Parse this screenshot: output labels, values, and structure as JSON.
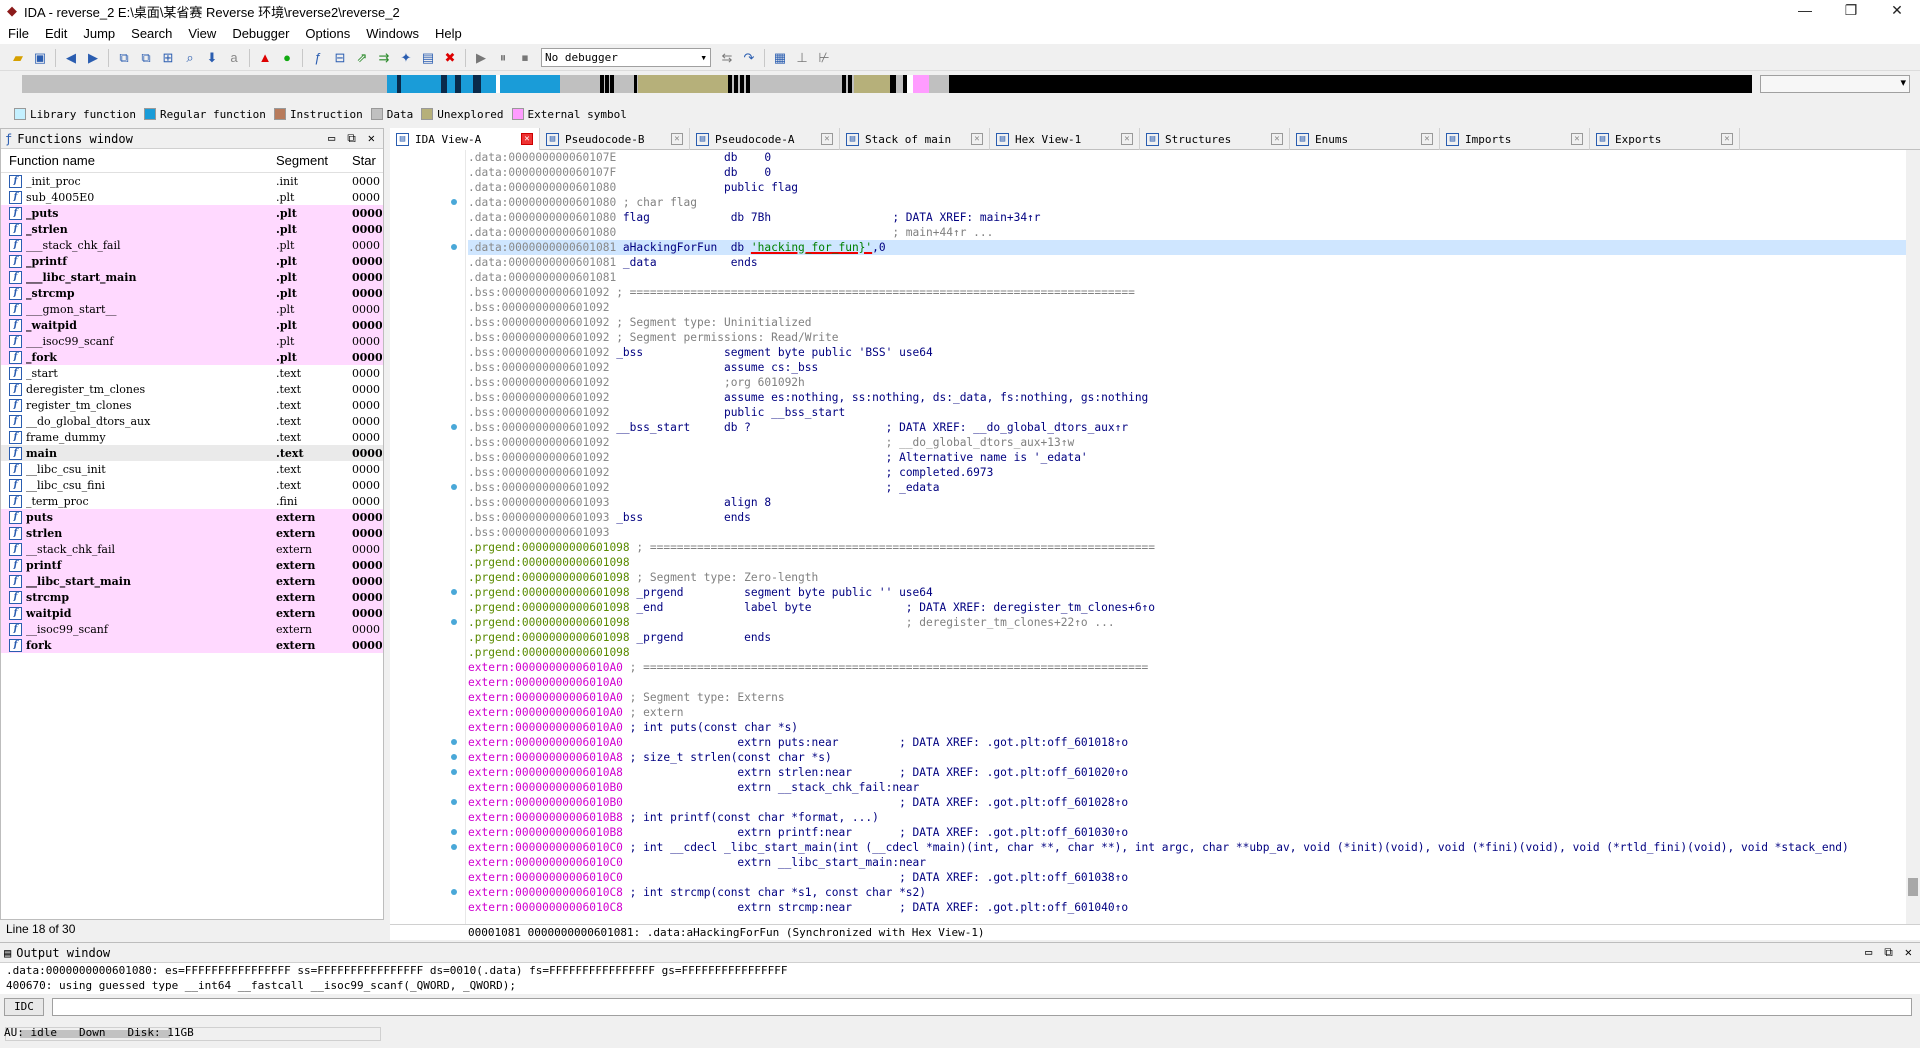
{
  "window": {
    "title": "IDA - reverse_2 E:\\桌面\\某省赛 Reverse 环境\\reverse2\\reverse_2"
  },
  "menu": [
    "File",
    "Edit",
    "Jump",
    "Search",
    "View",
    "Debugger",
    "Options",
    "Windows",
    "Help"
  ],
  "toolbar": {
    "debugger_select": "No debugger"
  },
  "legend": [
    {
      "label": "Library function",
      "color": "#c4f0ff"
    },
    {
      "label": "Regular function",
      "color": "#1a9cd8"
    },
    {
      "label": "Instruction",
      "color": "#b77b5c"
    },
    {
      "label": "Data",
      "color": "#c0c0c0"
    },
    {
      "label": "Unexplored",
      "color": "#b6b07a"
    },
    {
      "label": "External symbol",
      "color": "#ff9cff"
    }
  ],
  "functions_window": {
    "title": "Functions window",
    "columns": [
      "Function name",
      "Segment",
      "Star"
    ],
    "rows": [
      {
        "name": "_init_proc",
        "seg": ".init",
        "start": "0000",
        "style": ""
      },
      {
        "name": "sub_4005E0",
        "seg": ".plt",
        "start": "0000",
        "style": ""
      },
      {
        "name": "_puts",
        "seg": ".plt",
        "start": "0000",
        "style": "pink bold"
      },
      {
        "name": "_strlen",
        "seg": ".plt",
        "start": "0000",
        "style": "pink bold"
      },
      {
        "name": "___stack_chk_fail",
        "seg": ".plt",
        "start": "0000",
        "style": "pink"
      },
      {
        "name": "_printf",
        "seg": ".plt",
        "start": "0000",
        "style": "pink bold"
      },
      {
        "name": "___libc_start_main",
        "seg": ".plt",
        "start": "0000",
        "style": "pink bold"
      },
      {
        "name": "_strcmp",
        "seg": ".plt",
        "start": "0000",
        "style": "pink bold"
      },
      {
        "name": "___gmon_start__",
        "seg": ".plt",
        "start": "0000",
        "style": "pink"
      },
      {
        "name": "_waitpid",
        "seg": ".plt",
        "start": "0000",
        "style": "pink bold"
      },
      {
        "name": "___isoc99_scanf",
        "seg": ".plt",
        "start": "0000",
        "style": "pink"
      },
      {
        "name": "_fork",
        "seg": ".plt",
        "start": "0000",
        "style": "pink bold"
      },
      {
        "name": "_start",
        "seg": ".text",
        "start": "0000",
        "style": ""
      },
      {
        "name": "deregister_tm_clones",
        "seg": ".text",
        "start": "0000",
        "style": ""
      },
      {
        "name": "register_tm_clones",
        "seg": ".text",
        "start": "0000",
        "style": ""
      },
      {
        "name": "__do_global_dtors_aux",
        "seg": ".text",
        "start": "0000",
        "style": ""
      },
      {
        "name": "frame_dummy",
        "seg": ".text",
        "start": "0000",
        "style": ""
      },
      {
        "name": "main",
        "seg": ".text",
        "start": "0000",
        "style": "sel bold"
      },
      {
        "name": "__libc_csu_init",
        "seg": ".text",
        "start": "0000",
        "style": ""
      },
      {
        "name": "__libc_csu_fini",
        "seg": ".text",
        "start": "0000",
        "style": ""
      },
      {
        "name": "_term_proc",
        "seg": ".fini",
        "start": "0000",
        "style": ""
      },
      {
        "name": "puts",
        "seg": "extern",
        "start": "0000",
        "style": "pink bold"
      },
      {
        "name": "strlen",
        "seg": "extern",
        "start": "0000",
        "style": "pink bold"
      },
      {
        "name": "__stack_chk_fail",
        "seg": "extern",
        "start": "0000",
        "style": "pink"
      },
      {
        "name": "printf",
        "seg": "extern",
        "start": "0000",
        "style": "pink bold"
      },
      {
        "name": "__libc_start_main",
        "seg": "extern",
        "start": "0000",
        "style": "pink bold"
      },
      {
        "name": "strcmp",
        "seg": "extern",
        "start": "0000",
        "style": "pink bold"
      },
      {
        "name": "waitpid",
        "seg": "extern",
        "start": "0000",
        "style": "pink bold"
      },
      {
        "name": "__isoc99_scanf",
        "seg": "extern",
        "start": "0000",
        "style": "pink"
      },
      {
        "name": "fork",
        "seg": "extern",
        "start": "0000",
        "style": "pink bold"
      }
    ],
    "status": "Line 18 of 30"
  },
  "tabs": [
    {
      "label": "IDA View-A",
      "active": true
    },
    {
      "label": "Pseudocode-B",
      "active": false
    },
    {
      "label": "Pseudocode-A",
      "active": false
    },
    {
      "label": "Stack of main",
      "active": false
    },
    {
      "label": "Hex View-1",
      "active": false
    },
    {
      "label": "Structures",
      "active": false
    },
    {
      "label": "Enums",
      "active": false
    },
    {
      "label": "Imports",
      "active": false
    },
    {
      "label": "Exports",
      "active": false
    }
  ],
  "listing": [
    {
      "a": ".data:000000000060107E",
      "c": "                db    0",
      "t": "data"
    },
    {
      "a": ".data:000000000060107F",
      "c": "                db    0",
      "t": "data"
    },
    {
      "a": ".data:0000000000601080",
      "c": "                public flag",
      "t": "data"
    },
    {
      "a": ".data:0000000000601080",
      "c": " ; char flag",
      "t": "data",
      "cmt": true
    },
    {
      "a": ".data:0000000000601080",
      "c": " flag            db 7Bh                  ; DATA XREF: main+34↑r",
      "t": "data"
    },
    {
      "a": ".data:0000000000601080",
      "c": "                                         ; main+44↑r ...",
      "t": "data",
      "cmt": true
    },
    {
      "a": ".data:0000000000601081",
      "c": " aHackingForFun  db 'hacking_for_fun}',0",
      "t": "data",
      "sel": true
    },
    {
      "a": ".data:0000000000601081",
      "c": " _data           ends",
      "t": "data"
    },
    {
      "a": ".data:0000000000601081",
      "c": "",
      "t": "data"
    },
    {
      "a": ".bss:0000000000601092",
      "c": " ; ===========================================================================",
      "t": "bss",
      "cmt": true
    },
    {
      "a": ".bss:0000000000601092",
      "c": "",
      "t": "bss"
    },
    {
      "a": ".bss:0000000000601092",
      "c": " ; Segment type: Uninitialized",
      "t": "bss",
      "cmt": true
    },
    {
      "a": ".bss:0000000000601092",
      "c": " ; Segment permissions: Read/Write",
      "t": "bss",
      "cmt": true
    },
    {
      "a": ".bss:0000000000601092",
      "c": " _bss            segment byte public 'BSS' use64",
      "t": "bss"
    },
    {
      "a": ".bss:0000000000601092",
      "c": "                 assume cs:_bss",
      "t": "bss"
    },
    {
      "a": ".bss:0000000000601092",
      "c": "                 ;org 601092h",
      "t": "bss",
      "cmt": true
    },
    {
      "a": ".bss:0000000000601092",
      "c": "                 assume es:nothing, ss:nothing, ds:_data, fs:nothing, gs:nothing",
      "t": "bss"
    },
    {
      "a": ".bss:0000000000601092",
      "c": "                 public __bss_start",
      "t": "bss"
    },
    {
      "a": ".bss:0000000000601092",
      "c": " __bss_start     db ?                    ; DATA XREF: __do_global_dtors_aux↑r",
      "t": "bss"
    },
    {
      "a": ".bss:0000000000601092",
      "c": "                                         ; __do_global_dtors_aux+13↑w",
      "t": "bss",
      "cmt": true
    },
    {
      "a": ".bss:0000000000601092",
      "c": "                                         ; Alternative name is '_edata'",
      "t": "bss"
    },
    {
      "a": ".bss:0000000000601092",
      "c": "                                         ; completed.6973",
      "t": "bss"
    },
    {
      "a": ".bss:0000000000601092",
      "c": "                                         ; _edata",
      "t": "bss"
    },
    {
      "a": ".bss:0000000000601093",
      "c": "                 align 8",
      "t": "bss"
    },
    {
      "a": ".bss:0000000000601093",
      "c": " _bss            ends",
      "t": "bss"
    },
    {
      "a": ".bss:0000000000601093",
      "c": "",
      "t": "bss"
    },
    {
      "a": ".prgend:0000000000601098",
      "c": " ; ===========================================================================",
      "t": "prg",
      "cmt": true
    },
    {
      "a": ".prgend:0000000000601098",
      "c": "",
      "t": "prg"
    },
    {
      "a": ".prgend:0000000000601098",
      "c": " ; Segment type: Zero-length",
      "t": "prg",
      "cmt": true
    },
    {
      "a": ".prgend:0000000000601098",
      "c": " _prgend         segment byte public '' use64",
      "t": "prg"
    },
    {
      "a": ".prgend:0000000000601098",
      "c": " _end            label byte              ; DATA XREF: deregister_tm_clones+6↑o",
      "t": "prg"
    },
    {
      "a": ".prgend:0000000000601098",
      "c": "                                         ; deregister_tm_clones+22↑o ...",
      "t": "prg",
      "cmt": true
    },
    {
      "a": ".prgend:0000000000601098",
      "c": " _prgend         ends",
      "t": "prg"
    },
    {
      "a": ".prgend:0000000000601098",
      "c": "",
      "t": "prg"
    },
    {
      "a": "extern:00000000006010A0",
      "c": " ; ===========================================================================",
      "t": "ext",
      "cmt": true
    },
    {
      "a": "extern:00000000006010A0",
      "c": "",
      "t": "ext"
    },
    {
      "a": "extern:00000000006010A0",
      "c": " ; Segment type: Externs",
      "t": "ext",
      "cmt": true
    },
    {
      "a": "extern:00000000006010A0",
      "c": " ; extern",
      "t": "ext",
      "cmt": true
    },
    {
      "a": "extern:00000000006010A0",
      "c": " ; int puts(const char *s)",
      "t": "ext"
    },
    {
      "a": "extern:00000000006010A0",
      "c": "                 extrn puts:near         ; DATA XREF: .got.plt:off_601018↑o",
      "t": "ext"
    },
    {
      "a": "extern:00000000006010A8",
      "c": " ; size_t strlen(const char *s)",
      "t": "ext"
    },
    {
      "a": "extern:00000000006010A8",
      "c": "                 extrn strlen:near       ; DATA XREF: .got.plt:off_601020↑o",
      "t": "ext"
    },
    {
      "a": "extern:00000000006010B0",
      "c": "                 extrn __stack_chk_fail:near",
      "t": "ext"
    },
    {
      "a": "extern:00000000006010B0",
      "c": "                                         ; DATA XREF: .got.plt:off_601028↑o",
      "t": "ext"
    },
    {
      "a": "extern:00000000006010B8",
      "c": " ; int printf(const char *format, ...)",
      "t": "ext"
    },
    {
      "a": "extern:00000000006010B8",
      "c": "                 extrn printf:near       ; DATA XREF: .got.plt:off_601030↑o",
      "t": "ext"
    },
    {
      "a": "extern:00000000006010C0",
      "c": " ; int __cdecl _libc_start_main(int (__cdecl *main)(int, char **, char **), int argc, char **ubp_av, void (*init)(void), void (*fini)(void), void (*rtld_fini)(void), void *stack_end)",
      "t": "ext"
    },
    {
      "a": "extern:00000000006010C0",
      "c": "                 extrn __libc_start_main:near",
      "t": "ext"
    },
    {
      "a": "extern:00000000006010C0",
      "c": "                                         ; DATA XREF: .got.plt:off_601038↑o",
      "t": "ext"
    },
    {
      "a": "extern:00000000006010C8",
      "c": " ; int strcmp(const char *s1, const char *s2)",
      "t": "ext"
    },
    {
      "a": "extern:00000000006010C8",
      "c": "                 extrn strcmp:near       ; DATA XREF: .got.plt:off_601040↑o",
      "t": "ext"
    }
  ],
  "listing_footer": "00001081 0000000000601081: .data:aHackingForFun (Synchronized with Hex View-1)",
  "output_window": {
    "title": "Output window",
    "lines": [
      ".data:0000000000601080: es=FFFFFFFFFFFFFFFF ss=FFFFFFFFFFFFFFFF ds=0010(.data) fs=FFFFFFFFFFFFFFFF gs=FFFFFFFFFFFFFFFF",
      "400670: using guessed type __int64 __fastcall __isoc99_scanf(_QWORD, _QWORD);"
    ]
  },
  "idc_label": "IDC",
  "status": {
    "au": "AU:",
    "state": "idle",
    "dir": "Down",
    "disk": "Disk: 11GB"
  },
  "icons": [
    "ida-app-icon",
    "open-icon",
    "save-icon",
    "back-icon",
    "forward-icon",
    "run-icon",
    "pause-icon",
    "stop-icon",
    "close-icon"
  ]
}
